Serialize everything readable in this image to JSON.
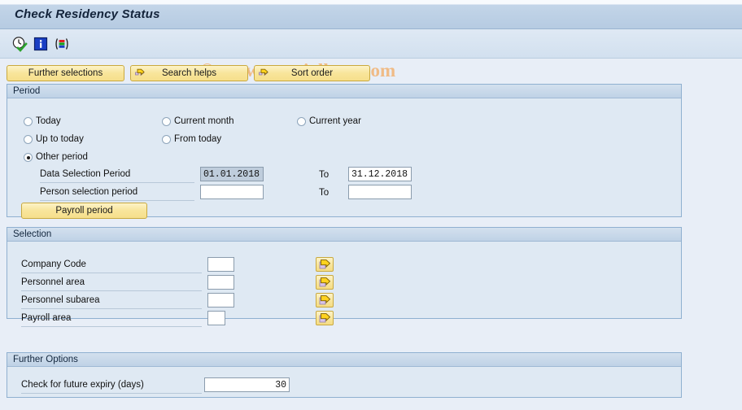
{
  "window": {
    "title": "Check Residency Status"
  },
  "toolbar": {
    "icons": [
      {
        "name": "execute-clock-icon",
        "label": "Execute"
      },
      {
        "name": "info-icon",
        "label": "Information"
      },
      {
        "name": "variants-icon",
        "label": "Get Variant"
      }
    ]
  },
  "watermark": {
    "text": "© www.tutorialkart.com"
  },
  "button_row": {
    "further_selections": "Further selections",
    "search_helps": "Search helps",
    "sort_order": "Sort order"
  },
  "period": {
    "header": "Period",
    "options": [
      {
        "label": "Today",
        "selected": false
      },
      {
        "label": "Current month",
        "selected": false
      },
      {
        "label": "Current year",
        "selected": false
      },
      {
        "label": "Up to today",
        "selected": false
      },
      {
        "label": "From today",
        "selected": false
      },
      {
        "label": "Other period",
        "selected": true
      }
    ],
    "data_selection_period_label": "Data Selection Period",
    "data_selection_period_from": "01.01.2018",
    "data_selection_period_to_label": "To",
    "data_selection_period_to": "31.12.2018",
    "person_selection_period_label": "Person selection period",
    "person_selection_period_from": "",
    "person_selection_period_to_label": "To",
    "person_selection_period_to": "",
    "payroll_period_button": "Payroll period"
  },
  "selection": {
    "header": "Selection",
    "rows": [
      {
        "label": "Company Code",
        "value": ""
      },
      {
        "label": "Personnel area",
        "value": ""
      },
      {
        "label": "Personnel subarea",
        "value": ""
      },
      {
        "label": "Payroll area",
        "value": ""
      }
    ]
  },
  "further_options": {
    "header": "Further Options",
    "expiry_label": "Check for future expiry (days)",
    "expiry_value": "30"
  },
  "colors": {
    "accent_yellow": "#f8e59b",
    "panel_bg": "#dfe9f3",
    "page_bg": "#e8eef7",
    "title_text": "#13233a",
    "watermark": "#f0bb86"
  }
}
